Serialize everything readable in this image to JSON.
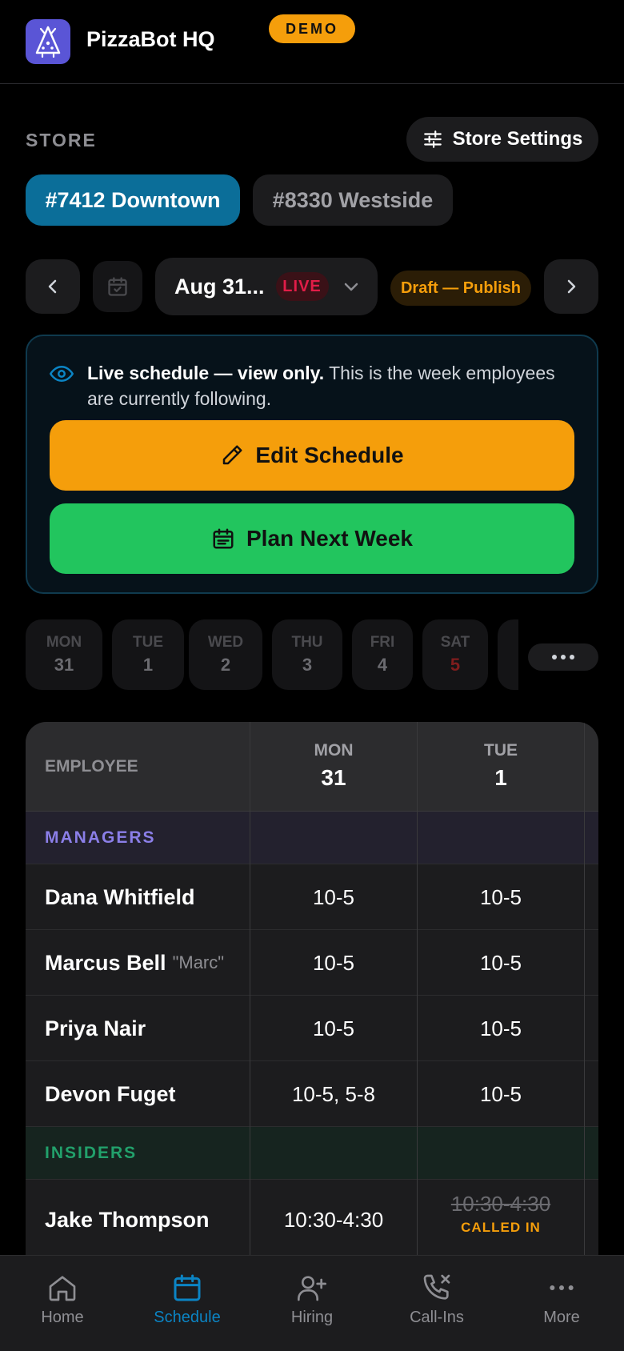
{
  "app": {
    "title": "PizzaBot HQ",
    "badge": "DEMO"
  },
  "store": {
    "label": "STORE",
    "settings_label": "Store Settings",
    "stores": [
      "#7412 Downtown",
      "#8330 Westside"
    ],
    "selected": "#7412 Downtown"
  },
  "week": {
    "label": "Aug 31...",
    "status": "LIVE",
    "draft_label": "Draft — Publish"
  },
  "info": {
    "bold": "Live schedule — view only.",
    "text": "This is the week employees are currently following.",
    "edit_label": "Edit Schedule",
    "plan_label": "Plan Next Week"
  },
  "days": [
    {
      "name": "MON",
      "num": "31"
    },
    {
      "name": "TUE",
      "num": "1"
    },
    {
      "name": "WED",
      "num": "2"
    },
    {
      "name": "THU",
      "num": "3"
    },
    {
      "name": "FRI",
      "num": "4"
    },
    {
      "name": "SAT",
      "num": "5"
    }
  ],
  "table": {
    "employee_header": "EMPLOYEE",
    "columns": [
      {
        "name": "MON",
        "num": "31"
      },
      {
        "name": "TUE",
        "num": "1"
      }
    ],
    "groups": [
      {
        "name": "MANAGERS",
        "rows": [
          {
            "name": "Dana Whitfield",
            "nick": "",
            "shifts": [
              "10-5",
              "10-5"
            ]
          },
          {
            "name": "Marcus Bell",
            "nick": "\"Marc\"",
            "shifts": [
              "10-5",
              "10-5"
            ]
          },
          {
            "name": "Priya Nair",
            "nick": "",
            "shifts": [
              "10-5",
              "10-5"
            ]
          },
          {
            "name": "Devon Fuget",
            "nick": "",
            "shifts": [
              "10-5, 5-8",
              "10-5"
            ]
          }
        ]
      },
      {
        "name": "INSIDERS",
        "rows": [
          {
            "name": "Jake Thompson",
            "nick": "",
            "shifts": [
              "10:30-4:30",
              "10:30-4:30"
            ],
            "called_in_note": "CALLED IN"
          }
        ]
      }
    ]
  },
  "nav": {
    "items": [
      "Home",
      "Schedule",
      "Hiring",
      "Call-Ins",
      "More"
    ],
    "active": "Schedule"
  },
  "colors": {
    "accent": "#0b6e99",
    "warning": "#f59e0b",
    "success": "#22c55e",
    "live": "#e11d48"
  }
}
